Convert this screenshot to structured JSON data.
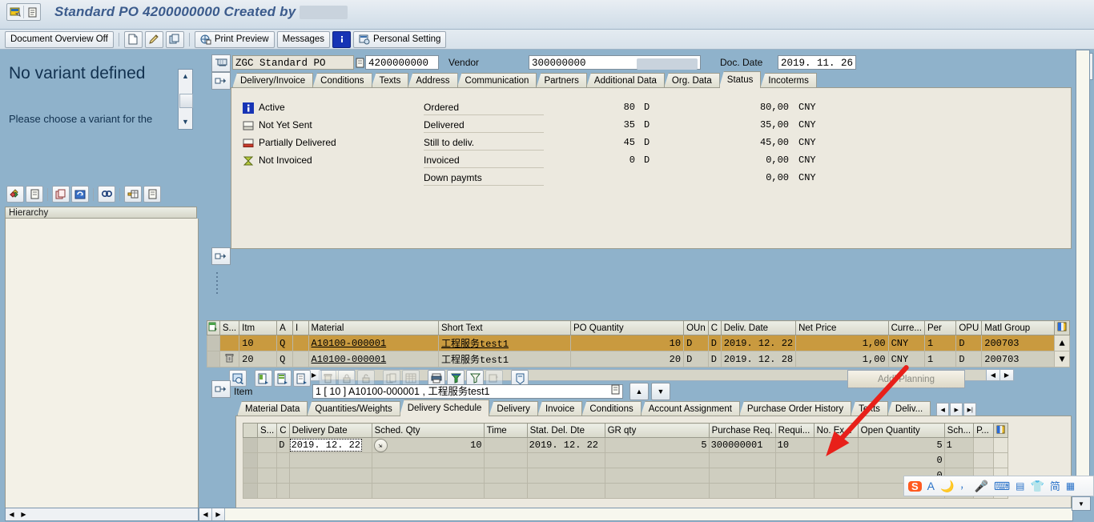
{
  "window": {
    "title": "Standard PO 4200000000 Created by",
    "title_redacted": true
  },
  "toolbar": {
    "document_overview": "Document Overview Off",
    "print_preview": "Print Preview",
    "messages": "Messages",
    "personal_setting": "Personal Setting",
    "icons": [
      "new-document-icon",
      "pencil-icon",
      "copy-icon",
      "print-preview-icon",
      "info-icon",
      "personal-setting-icon"
    ]
  },
  "variant_panel": {
    "title": "No variant defined",
    "subtitle": "Please choose a variant for the",
    "hierarchy_header": "Hierarchy",
    "toolbar_icons": [
      "variant-icon",
      "detail-icon",
      "copy-icon",
      "refresh-icon",
      "find-icon",
      "layout-icon",
      "note-icon"
    ]
  },
  "header": {
    "doc_type": "ZGC Standard PO",
    "doc_number": "4200000000",
    "vendor_label": "Vendor",
    "vendor_number": "300000000",
    "vendor_name_redacted": true,
    "doc_date_label": "Doc. Date",
    "doc_date": "2019. 11. 26",
    "tabs": [
      {
        "label": "Delivery/Invoice",
        "active": false
      },
      {
        "label": "Conditions",
        "active": false
      },
      {
        "label": "Texts",
        "active": false
      },
      {
        "label": "Address",
        "active": false
      },
      {
        "label": "Communication",
        "active": false
      },
      {
        "label": "Partners",
        "active": false
      },
      {
        "label": "Additional Data",
        "active": false
      },
      {
        "label": "Org. Data",
        "active": false
      },
      {
        "label": "Status",
        "active": true
      },
      {
        "label": "Incoterms",
        "active": false
      }
    ],
    "status_flags": [
      {
        "icon": "info-icon",
        "label": "Active"
      },
      {
        "icon": "not-sent-icon",
        "label": "Not Yet Sent"
      },
      {
        "icon": "partially-delivered-icon",
        "label": "Partially Delivered"
      },
      {
        "icon": "not-invoiced-icon",
        "label": "Not Invoiced"
      }
    ],
    "status_rows": [
      {
        "label": "Ordered",
        "qty": "80",
        "qty_unit": "D",
        "value": "80,00",
        "currency": "CNY"
      },
      {
        "label": "Delivered",
        "qty": "35",
        "qty_unit": "D",
        "value": "35,00",
        "currency": "CNY"
      },
      {
        "label": "Still to deliv.",
        "qty": "45",
        "qty_unit": "D",
        "value": "45,00",
        "currency": "CNY"
      },
      {
        "label": "Invoiced",
        "qty": "0",
        "qty_unit": "D",
        "value": "0,00",
        "currency": "CNY"
      },
      {
        "label": "Down paymts",
        "qty": "",
        "qty_unit": "",
        "value": "0,00",
        "currency": "CNY"
      }
    ]
  },
  "item_grid": {
    "columns": [
      "S...",
      "Itm",
      "A",
      "I",
      "Material",
      "Short Text",
      "PO Quantity",
      "OUn",
      "C",
      "Deliv. Date",
      "Net Price",
      "Curre...",
      "Per",
      "OPU",
      "Matl Group"
    ],
    "rows": [
      {
        "selected": true,
        "marker": "selected-block-icon",
        "itm": "10",
        "a": "Q",
        "i": "",
        "material": "A10100-000001",
        "short_text": "工程服务test1",
        "po_quantity": "10",
        "oun": "D",
        "c": "D",
        "deliv_date": "2019. 12. 22",
        "net_price": "1,00",
        "currency": "CNY",
        "per": "1",
        "opu": "D",
        "matl_group": "200703"
      },
      {
        "selected": false,
        "marker": "trash-icon",
        "itm": "20",
        "a": "Q",
        "i": "",
        "material": "A10100-000001",
        "short_text": "工程服务test1",
        "po_quantity": "20",
        "oun": "D",
        "c": "D",
        "deliv_date": "2019. 12. 28",
        "net_price": "1,00",
        "currency": "CNY",
        "per": "1",
        "opu": "D",
        "matl_group": "200703"
      }
    ],
    "addl_planning_button": "Addl Planning",
    "toolbar_icons": [
      "search-icon",
      "detail-item-icon",
      "insert-item-icon",
      "copy-item-icon",
      "delete-icon",
      "lock-icon",
      "unlock-icon",
      "duplicate-icon",
      "table-icon",
      "print-icon",
      "filter-fill-icon",
      "filter-icon",
      "refresh-cell-icon",
      "find-doc-icon"
    ]
  },
  "detail": {
    "item_label": "Item",
    "item_value": "1 [ 10 ] A10100-000001 , 工程服务test1",
    "tabs": [
      {
        "label": "Material Data",
        "active": false
      },
      {
        "label": "Quantities/Weights",
        "active": false
      },
      {
        "label": "Delivery Schedule",
        "active": true
      },
      {
        "label": "Delivery",
        "active": false
      },
      {
        "label": "Invoice",
        "active": false
      },
      {
        "label": "Conditions",
        "active": false
      },
      {
        "label": "Account Assignment",
        "active": false
      },
      {
        "label": "Purchase Order History",
        "active": false
      },
      {
        "label": "Texts",
        "active": false
      },
      {
        "label": "Deliv...",
        "active": false
      }
    ],
    "schedule_columns": [
      "S...",
      "C",
      "Delivery Date",
      "Sched. Qty",
      "Time",
      "Stat. Del. Dte",
      "GR qty",
      "Purchase Req.",
      "Requi...",
      "No. Ex...",
      "Open Quantity",
      "Sch...",
      "P..."
    ],
    "schedule_rows": [
      {
        "s": "",
        "c": "D",
        "delivery_date": "2019. 12. 22",
        "delivery_date_selected": true,
        "sched_qty": "10",
        "time": "",
        "stat_del_dte": "2019. 12. 22",
        "gr_qty": "5",
        "purchase_req": "300000001",
        "requi": "10",
        "no_ex": "",
        "open_quantity": "5",
        "sch": "1",
        "p": ""
      },
      {
        "s": "",
        "c": "",
        "delivery_date": "",
        "sched_qty": "",
        "time": "",
        "stat_del_dte": "",
        "gr_qty": "",
        "purchase_req": "",
        "requi": "",
        "no_ex": "",
        "open_quantity": "0",
        "sch": "",
        "p": ""
      },
      {
        "s": "",
        "c": "",
        "delivery_date": "",
        "sched_qty": "",
        "time": "",
        "stat_del_dte": "",
        "gr_qty": "",
        "purchase_req": "",
        "requi": "",
        "no_ex": "",
        "open_quantity": "0",
        "sch": "",
        "p": ""
      },
      {
        "s": "",
        "c": "",
        "delivery_date": "",
        "sched_qty": "",
        "time": "",
        "stat_del_dte": "",
        "gr_qty": "",
        "purchase_req": "",
        "requi": "",
        "no_ex": "",
        "open_quantity": "0",
        "sch": "",
        "p": ""
      }
    ]
  },
  "annotation": {
    "arrow_color": "#e8201a",
    "points_to": "Open Quantity"
  },
  "ime": {
    "items": [
      "sogou-logo-icon",
      "A",
      "moon-icon",
      "punctuation-icon",
      "microphone-icon",
      "keyboard-icon",
      "input-method-icon",
      "skin-icon",
      "简",
      "toolbox-icon"
    ]
  },
  "colors": {
    "window_bg": "#8fb2cb",
    "panel_bg": "#ece9df",
    "grid_row": "#cfcec0",
    "selected_row": "#c99a3f",
    "title_color": "#3b5b8c"
  }
}
